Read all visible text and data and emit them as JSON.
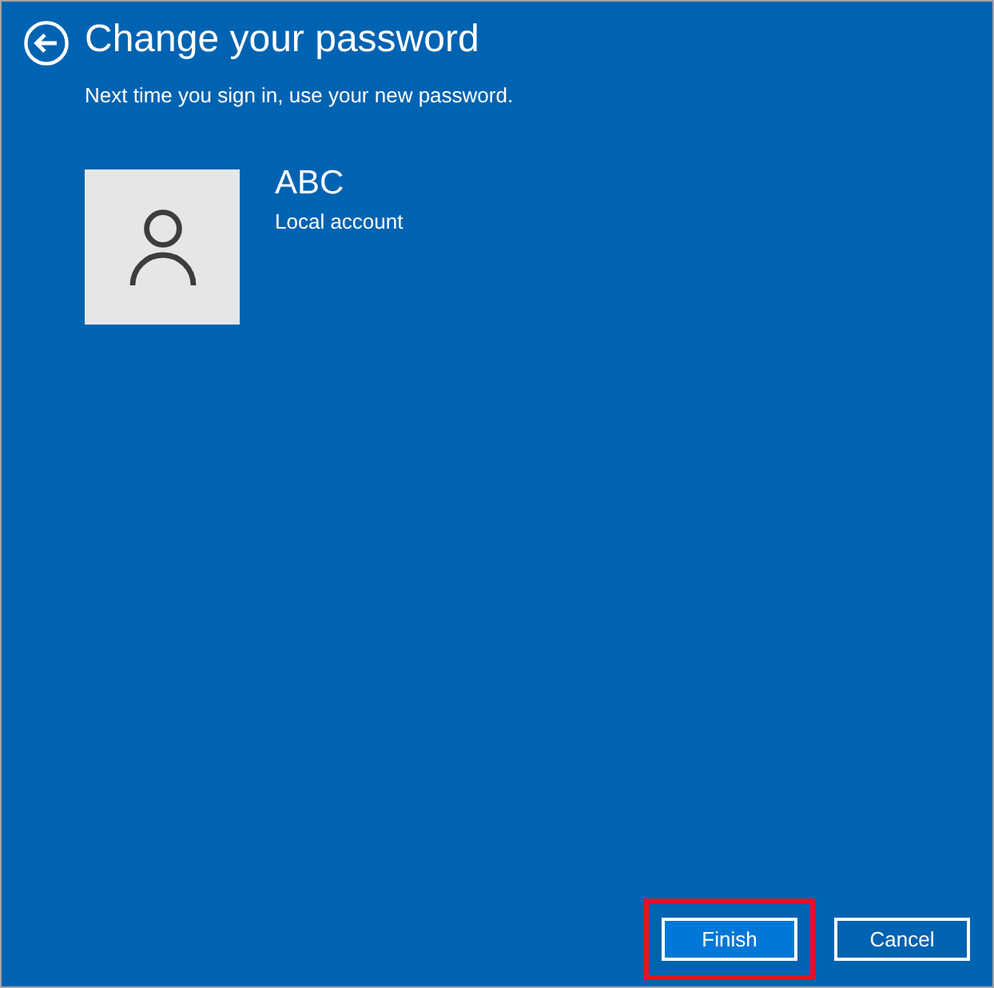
{
  "header": {
    "title": "Change your password",
    "subtitle": "Next time you sign in, use your new password."
  },
  "account": {
    "name": "ABC",
    "type": "Local account"
  },
  "buttons": [
    {
      "label": "Finish",
      "kind": "primary",
      "highlighted": true
    },
    {
      "label": "Cancel",
      "kind": "secondary",
      "highlighted": false
    }
  ]
}
